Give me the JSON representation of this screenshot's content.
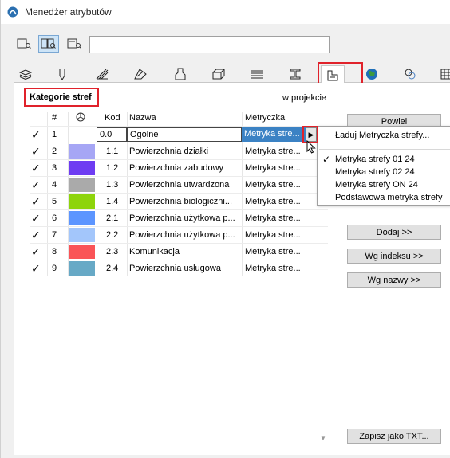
{
  "window": {
    "title": "Menedżer atrybutów"
  },
  "toolbar": {
    "view_icons": [
      "list-view-icon",
      "compare-view-icon",
      "detail-view-icon"
    ],
    "search_value": ""
  },
  "tabs": [
    {
      "icon": "layers-icon"
    },
    {
      "icon": "pen-icon"
    },
    {
      "icon": "line-type-icon"
    },
    {
      "icon": "fill-icon"
    },
    {
      "icon": "surface-icon"
    },
    {
      "icon": "building-material-icon"
    },
    {
      "icon": "composite-icon"
    },
    {
      "icon": "profile-icon"
    },
    {
      "icon": "zone-category-icon",
      "selected": true
    },
    {
      "icon": "globe-icon"
    },
    {
      "icon": "mep-icon"
    },
    {
      "icon": "grid-icon"
    }
  ],
  "panel": {
    "title": "Kategorie stref",
    "in_project_label": "w projekcie"
  },
  "table": {
    "headers": {
      "num": "#",
      "color_icon": "color-wheel-icon",
      "code": "Kod",
      "name": "Nazwa",
      "metric": "Metryczka"
    },
    "rows": [
      {
        "checked": true,
        "num": "1",
        "color": "#ffffff",
        "code": "0.0",
        "name": "Ogólne",
        "metric": "Metryka stre...",
        "selected": true
      },
      {
        "checked": true,
        "num": "2",
        "color": "#a6a6f5",
        "code": "1.1",
        "name": "Powierzchnia działki",
        "metric": "Metryka stre..."
      },
      {
        "checked": true,
        "num": "3",
        "color": "#6e3cf2",
        "code": "1.2",
        "name": "Powierzchnia zabudowy",
        "metric": "Metryka stre..."
      },
      {
        "checked": true,
        "num": "4",
        "color": "#aaaaaa",
        "code": "1.3",
        "name": "Powierzchnia utwardzona",
        "metric": "Metryka stre..."
      },
      {
        "checked": true,
        "num": "5",
        "color": "#8ed40b",
        "code": "1.4",
        "name": "Powierzchnia biologiczni...",
        "metric": "Metryka stre..."
      },
      {
        "checked": true,
        "num": "6",
        "color": "#5c95ff",
        "code": "2.1",
        "name": "Powierzchnia użytkowa p...",
        "metric": "Metryka stre..."
      },
      {
        "checked": true,
        "num": "7",
        "color": "#a3c6fb",
        "code": "2.2",
        "name": "Powierzchnia użytkowa p...",
        "metric": "Metryka stre..."
      },
      {
        "checked": true,
        "num": "8",
        "color": "#fa5457",
        "code": "2.3",
        "name": "Komunikacja",
        "metric": "Metryka stre..."
      },
      {
        "checked": true,
        "num": "9",
        "color": "#67a9c6",
        "code": "2.4",
        "name": "Powierzchnia usługowa",
        "metric": "Metryka stre..."
      }
    ]
  },
  "buttons": {
    "duplicate": "Powiel",
    "add": "Dodaj >>",
    "by_index": "Wg indeksu >>",
    "by_name": "Wg nazwy >>",
    "save_txt": "Zapisz jako TXT..."
  },
  "menu": {
    "load_label": "Ładuj Metryczka strefy...",
    "items": [
      {
        "label": "Metryka strefy 01 24",
        "checked": true
      },
      {
        "label": "Metryka strefy 02 24",
        "checked": false
      },
      {
        "label": "Metryka strefy ON 24",
        "checked": false
      },
      {
        "label": "Podstawowa metryka strefy",
        "checked": false
      }
    ]
  },
  "colors": {
    "highlight": "#e0222b",
    "selection": "#3b82c4",
    "accent_active": "#cde4f7"
  }
}
